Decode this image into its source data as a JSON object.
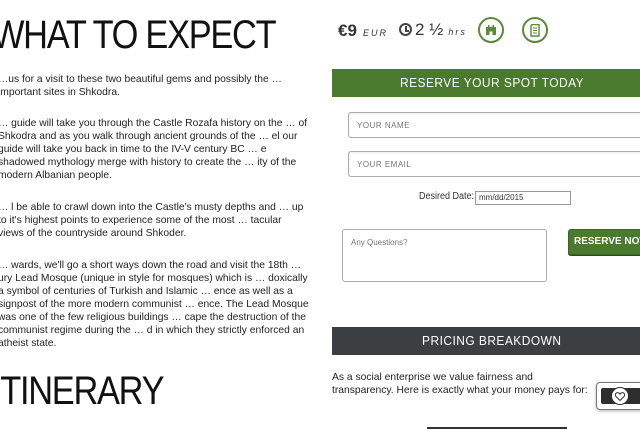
{
  "left": {
    "heading_expect": "WHAT TO EXPECT",
    "paragraphs": [
      "…us for a visit to these two beautiful gems and possibly the … important sites in Shkodra.",
      "… guide will take you through the Castle Rozafa history on the … of Shkodra and as you walk through ancient grounds of the … el our guide will take you back in time to the IV-V century BC … e shadowed mythology merge with history to create the … ity of the modern Albanian people.",
      "… l be able to crawl down into the Castle's musty depths and … up to it's highest points to experience some of the most … tacular views of the countryside around Shkoder.",
      "… wards, we'll go a short ways down the road and visit the 18th … ury Lead Mosque (unique in style for mosques) which is … doxically a symbol of centuries of Turkish and Islamic … ence as well as a signpost of the more modern communist … ence. The Lead Mosque was one of the few religious buildings … cape the destruction of the communist regime during the … d in which they strictly enforced an atheist state."
    ],
    "heading_itinerary": "ITINERARY"
  },
  "price": {
    "currency_symbol": "€",
    "amount": "9",
    "unit": "EUR"
  },
  "duration": {
    "value": "2 ½",
    "unit": "hrs"
  },
  "icons": {
    "castle": "castle-icon",
    "mosque": "mosque-icon",
    "clock": "clock-icon"
  },
  "reserve": {
    "title": "RESERVE YOUR SPOT TODAY",
    "name_placeholder": "YOUR NAME",
    "email_placeholder": "YOUR EMAIL",
    "date_label": "Desired Date:",
    "date_value": "mm/dd/2015",
    "questions_placeholder": "Any Questions?",
    "button_label": "RESERVE NOW"
  },
  "pricing": {
    "title": "PRICING BREAKDOWN",
    "intro": "As a social enterprise we value fairness and transparency. Here is exactly what your money pays for:"
  },
  "colors": {
    "accent_green": "#4a7a2e",
    "dark_bar": "#3c3f42"
  }
}
